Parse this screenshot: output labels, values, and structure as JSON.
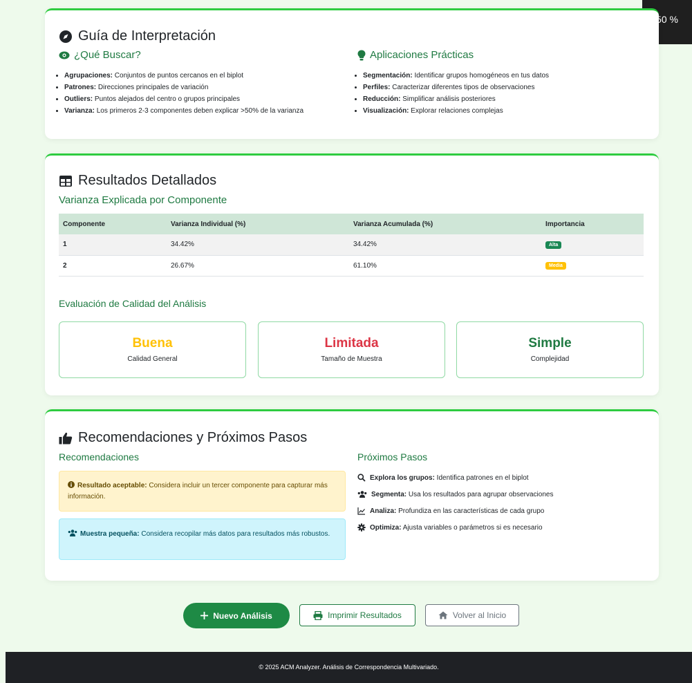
{
  "zoom": "50 %",
  "guide": {
    "title": "Guía de Interpretación",
    "what_title": "¿Qué Buscar?",
    "what_items": [
      {
        "term": "Agrupaciones:",
        "text": " Conjuntos de puntos cercanos en el biplot"
      },
      {
        "term": "Patrones:",
        "text": " Direcciones principales de variación"
      },
      {
        "term": "Outliers:",
        "text": " Puntos alejados del centro o grupos principales"
      },
      {
        "term": "Varianza:",
        "text": " Los primeros 2-3 componentes deben explicar >50% de la varianza"
      }
    ],
    "apps_title": "Aplicaciones Prácticas",
    "apps_items": [
      {
        "term": "Segmentación:",
        "text": " Identificar grupos homogéneos en tus datos"
      },
      {
        "term": "Perfiles:",
        "text": " Caracterizar diferentes tipos de observaciones"
      },
      {
        "term": "Reducción:",
        "text": " Simplificar análisis posteriores"
      },
      {
        "term": "Visualización:",
        "text": " Explorar relaciones complejas"
      }
    ]
  },
  "results": {
    "title": "Resultados Detallados",
    "variance_title": "Varianza Explicada por Componente",
    "headers": [
      "Componente",
      "Varianza Individual (%)",
      "Varianza Acumulada (%)",
      "Importancia"
    ],
    "rows": [
      {
        "component": "1",
        "individual": "34.42%",
        "cumulative": "34.42%",
        "importance": "Alta",
        "color": "#198754"
      },
      {
        "component": "2",
        "individual": "26.67%",
        "cumulative": "61.10%",
        "importance": "Media",
        "color": "#ffc107"
      }
    ],
    "quality_title": "Evaluación de Calidad del Análisis",
    "quality": [
      {
        "value": "Buena",
        "label": "Calidad General",
        "color": "#ffc107"
      },
      {
        "value": "Limitada",
        "label": "Tamaño de Muestra",
        "color": "#dc3545"
      },
      {
        "value": "Simple",
        "label": "Complejidad",
        "color": "#1f7a42"
      }
    ]
  },
  "recs": {
    "title": "Recomendaciones y Próximos Pasos",
    "left_title": "Recomendaciones",
    "alert1_term": "Resultado aceptable:",
    "alert1_text": " Considera incluir un tercer componente para capturar más información.",
    "alert2_term": "Muestra pequeña:",
    "alert2_text": " Considera recopilar más datos para resultados más robustos.",
    "right_title": "Próximos Pasos",
    "steps": [
      {
        "icon": "search-icon",
        "term": "Explora los grupos:",
        "text": " Identifica patrones en el biplot"
      },
      {
        "icon": "users-icon",
        "term": "Segmenta:",
        "text": " Usa los resultados para agrupar observaciones"
      },
      {
        "icon": "chart-line-icon",
        "term": "Analiza:",
        "text": " Profundiza en las características de cada grupo"
      },
      {
        "icon": "gear-icon",
        "term": "Optimiza:",
        "text": " Ajusta variables o parámetros si es necesario"
      }
    ]
  },
  "buttons": {
    "new": "Nuevo Análisis",
    "print": "Imprimir Resultados",
    "home": "Volver al Inicio"
  },
  "colors": {
    "accent": "#1f7a42",
    "button_green": "#1e8a45",
    "card_border": "#2ecc40"
  },
  "footer": "© 2025 ACM Analyzer. Análisis de Correspondencia Multivariado."
}
